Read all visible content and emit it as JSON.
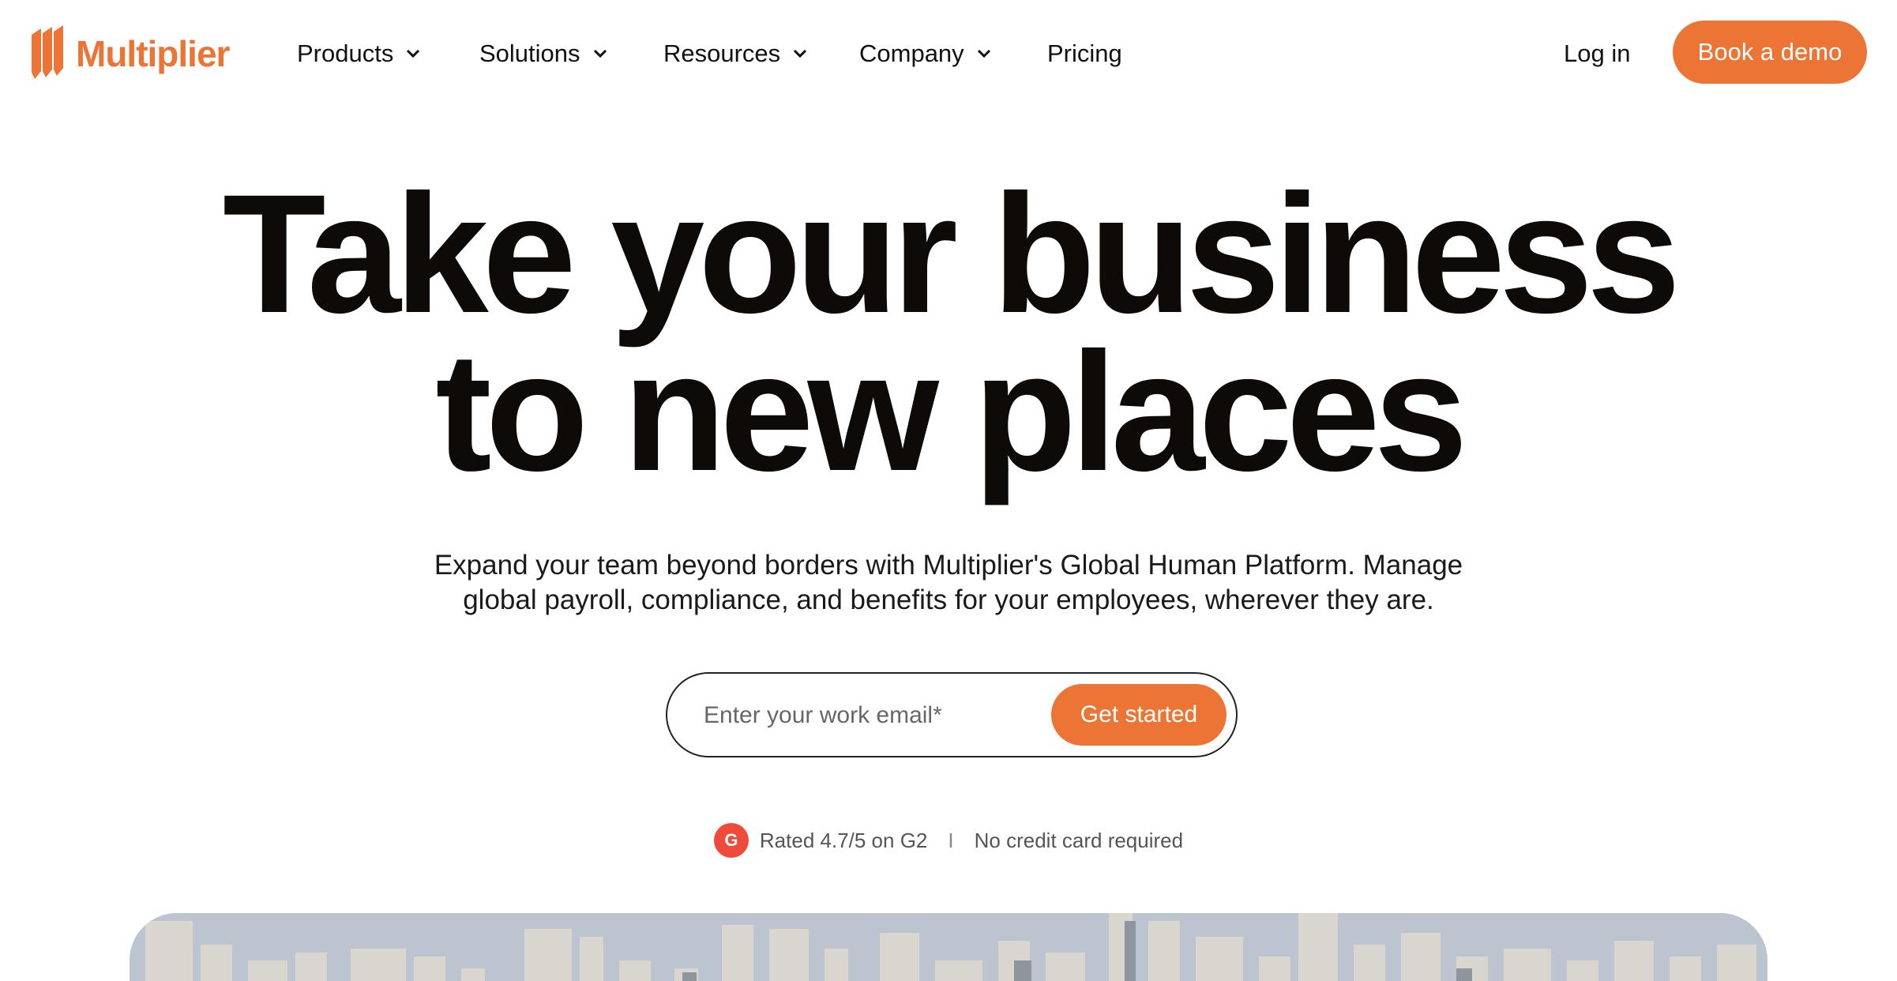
{
  "brand": {
    "name": "Multiplier",
    "accent_color": "#ec7535"
  },
  "nav": {
    "items": [
      {
        "label": "Products",
        "has_dropdown": true
      },
      {
        "label": "Solutions",
        "has_dropdown": true
      },
      {
        "label": "Resources",
        "has_dropdown": true
      },
      {
        "label": "Company",
        "has_dropdown": true
      },
      {
        "label": "Pricing",
        "has_dropdown": false
      }
    ],
    "login_label": "Log in",
    "demo_label": "Book a demo"
  },
  "hero": {
    "headline_line1": "Take your business",
    "headline_line2": "to new places",
    "sub_line1": "Expand your team beyond borders with Multiplier's Global Human Platform. Manage",
    "sub_line2": "global payroll, compliance, and benefits for your employees, wherever they are.",
    "email_placeholder": "Enter your work email*",
    "cta_label": "Get started",
    "rating_text": "Rated 4.7/5 on G2",
    "separator": "I",
    "no_card_text": "No credit card required",
    "g2_icon_color": "#ef4b3a"
  },
  "icons": [
    "multiplier-logo-icon",
    "chevron-down-icon",
    "g2-icon"
  ]
}
